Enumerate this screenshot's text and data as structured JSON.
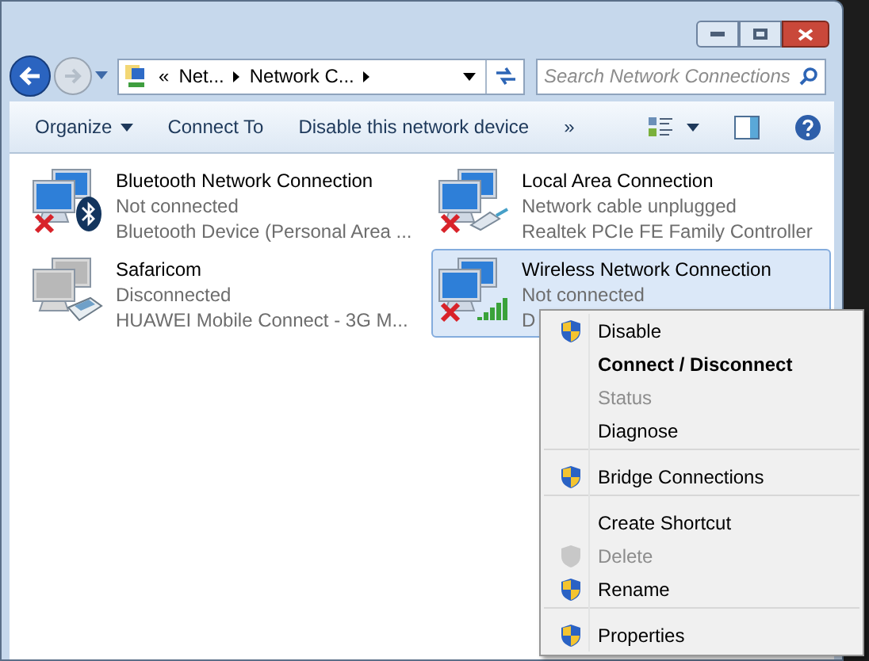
{
  "address_bar": {
    "crumbs": [
      "«",
      "Net...",
      "Network C..."
    ]
  },
  "search": {
    "placeholder": "Search Network Connections"
  },
  "toolbar": [
    {
      "label": "Organize",
      "dropdown": true
    },
    {
      "label": "Connect To",
      "dropdown": false
    },
    {
      "label": "Disable this network device",
      "dropdown": false
    },
    {
      "label": "»",
      "dropdown": false
    }
  ],
  "connections": [
    {
      "name": "Bluetooth Network Connection",
      "status": "Not connected",
      "device": "Bluetooth Device (Personal Area ...",
      "kind": "bluetooth",
      "error": true,
      "greyed": false,
      "selected": false
    },
    {
      "name": "Local Area Connection",
      "status": "Network cable unplugged",
      "device": "Realtek PCIe FE Family Controller",
      "kind": "cable",
      "error": true,
      "greyed": false,
      "selected": false
    },
    {
      "name": "Safaricom",
      "status": "Disconnected",
      "device": "HUAWEI Mobile Connect - 3G M...",
      "kind": "phone",
      "error": false,
      "greyed": true,
      "selected": false
    },
    {
      "name": "Wireless Network Connection",
      "status": "Not connected",
      "device": "D",
      "kind": "signal",
      "error": true,
      "greyed": false,
      "selected": true
    }
  ],
  "context_menu": [
    {
      "label": "Disable",
      "shield": true,
      "bold": false,
      "disabled": false,
      "separator_before": false
    },
    {
      "label": "Connect / Disconnect",
      "shield": false,
      "bold": true,
      "disabled": false,
      "separator_before": false
    },
    {
      "label": "Status",
      "shield": false,
      "bold": false,
      "disabled": true,
      "separator_before": false
    },
    {
      "label": "Diagnose",
      "shield": false,
      "bold": false,
      "disabled": false,
      "separator_before": false
    },
    {
      "label": "Bridge Connections",
      "shield": true,
      "bold": false,
      "disabled": false,
      "separator_before": true
    },
    {
      "label": "Create Shortcut",
      "shield": false,
      "bold": false,
      "disabled": false,
      "separator_before": true
    },
    {
      "label": "Delete",
      "shield": true,
      "bold": false,
      "disabled": true,
      "separator_before": false
    },
    {
      "label": "Rename",
      "shield": true,
      "bold": false,
      "disabled": false,
      "separator_before": false
    },
    {
      "label": "Properties",
      "shield": true,
      "bold": false,
      "disabled": false,
      "separator_before": true
    }
  ]
}
